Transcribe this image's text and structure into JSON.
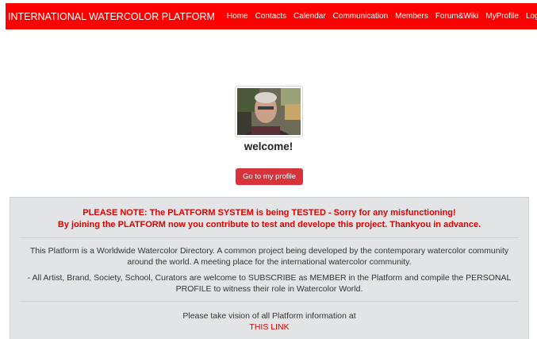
{
  "navbar": {
    "brand": "INTERNATIONAL WATERCOLOR PLATFORM",
    "links": [
      "Home",
      "Contacts",
      "Calendar",
      "Communication",
      "Members",
      "Forum&Wiki",
      "MyProfile",
      "Login/Subscribe"
    ]
  },
  "profile": {
    "welcome": "welcome!",
    "button_label": "Go to my profile"
  },
  "notice": {
    "line1": "PLEASE NOTE: The PLATFORM SYSTEM is being TESTED - Sorry for any misfunctioning!",
    "line2": "By joining the PLATFORM now you contribute to test and develope this project. Thankyou in advance."
  },
  "info": {
    "paragraph1": "This Platform is a Worldwide Watercolor Directory. A common project being developed by the contemporary watercolor community around the world. A meeting place for the international watercolor community.",
    "paragraph2": "- All Artist, Brand, Society, School, Curators are welcome to SUBSCRIBE as MEMBER in the Platform and compile the PERSONAL PROFILE to witness their role in Watercolor World.",
    "vision_text": "Please take vision of all Platform information at",
    "link_label": "THIS LINK"
  },
  "colors": {
    "navbar": "#fe0000",
    "button": "#d8333a",
    "panel": "#e2e4e6",
    "notice": "#e00000"
  }
}
